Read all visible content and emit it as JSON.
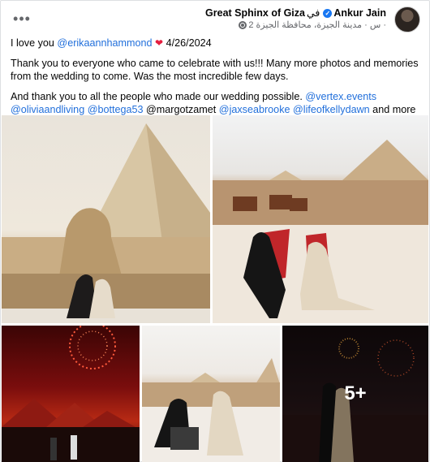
{
  "header": {
    "author": "Ankur Jain",
    "in_word": "في",
    "place": "Great Sphinx of Giza",
    "meta": "2 س · مدينة الجيزة، محافظة الجيزة ·",
    "more_label": "•••"
  },
  "post": {
    "line1_prefix": "I love you ",
    "line1_mention": "@erikaannhammond",
    "line1_heart": "❤",
    "line1_date": " 4/26/2024",
    "para2": "Thank you to everyone who came to celebrate with us!!! Many more photos and memories from the wedding to come. Was the most incredible few days.",
    "para3_prefix": "And thank you to all the people who made our wedding possible. ",
    "mentions": [
      "@vertex.events",
      "@oliviaandliving",
      "@bottega53"
    ],
    "plain_mention": " @margotzamet ",
    "mentions2": [
      "@jaxseabrooke",
      "@lifeofkellydawn"
    ],
    "suffix": " and more !"
  },
  "photos": {
    "more_count": "5+"
  },
  "colors": {
    "link": "#216fdb",
    "verified": "#1877f2",
    "heart": "#e41e3f"
  }
}
